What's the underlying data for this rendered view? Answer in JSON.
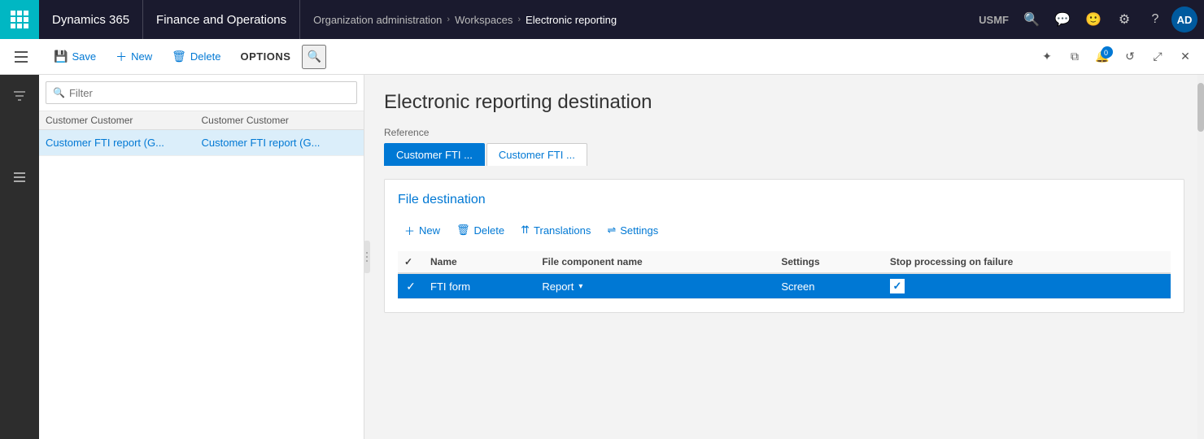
{
  "topnav": {
    "waffle_label": "Apps",
    "d365_label": "Dynamics 365",
    "fao_label": "Finance and Operations",
    "breadcrumb": {
      "part1": "Organization administration",
      "part2": "Workspaces",
      "part3": "Electronic reporting"
    },
    "env_label": "USMF",
    "avatar_initials": "AD",
    "notification_count": "0"
  },
  "toolbar": {
    "save_label": "Save",
    "new_label": "New",
    "delete_label": "Delete",
    "options_label": "OPTIONS"
  },
  "list_panel": {
    "filter_placeholder": "Filter",
    "col1_header": "Customer Customer",
    "col2_header": "Customer Customer",
    "items": [
      {
        "col1": "Customer FTI report (G...",
        "col2": "Customer FTI report (G..."
      }
    ]
  },
  "content": {
    "page_title": "Electronic reporting destination",
    "reference_label": "Reference",
    "reference_tabs": [
      {
        "label": "Customer FTI ...",
        "active": true
      },
      {
        "label": "Customer FTI ...",
        "active": false
      }
    ],
    "file_destination": {
      "title": "File destination",
      "toolbar": {
        "new_label": "New",
        "delete_label": "Delete",
        "translations_label": "Translations",
        "settings_label": "Settings"
      },
      "table": {
        "headers": [
          "",
          "Name",
          "File component name",
          "Settings",
          "Stop processing on failure"
        ],
        "rows": [
          {
            "selected": true,
            "name": "FTI form",
            "file_component": "Report",
            "settings": "Screen",
            "stop_on_failure": true
          }
        ]
      }
    }
  }
}
